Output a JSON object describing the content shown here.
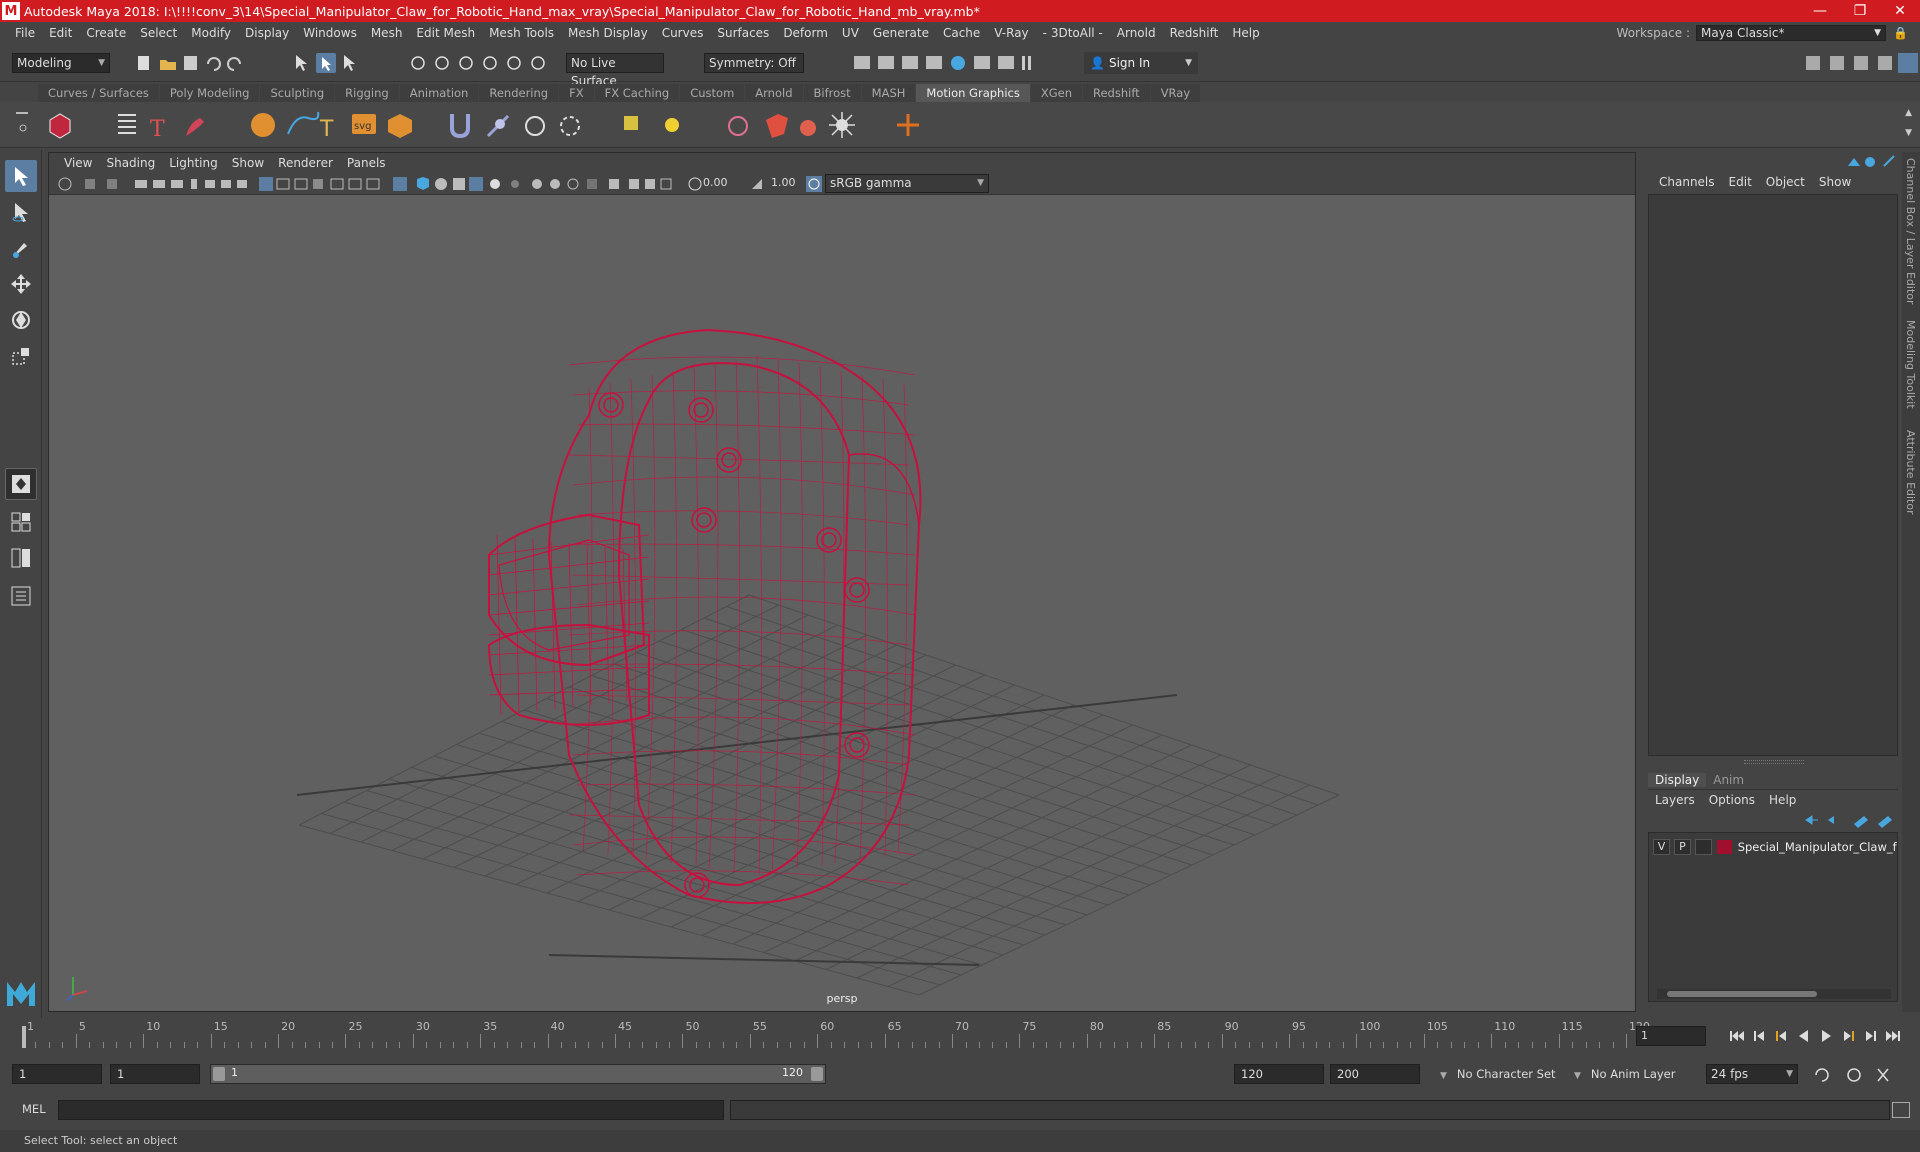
{
  "window": {
    "app_logo": "M",
    "title": "Autodesk Maya 2018: I:\\!!!!conv_3\\14\\Special_Manipulator_Claw_for_Robotic_Hand_max_vray\\Special_Manipulator_Claw_for_Robotic_Hand_mb_vray.mb*",
    "minimize": "—",
    "restore": "❐",
    "close": "✕"
  },
  "menubar": {
    "items": [
      "File",
      "Edit",
      "Create",
      "Select",
      "Modify",
      "Display",
      "Windows",
      "Mesh",
      "Edit Mesh",
      "Mesh Tools",
      "Mesh Display",
      "Curves",
      "Surfaces",
      "Deform",
      "UV",
      "Generate",
      "Cache",
      "V-Ray",
      "- 3DtoAll -",
      "Arnold",
      "Redshift",
      "Help"
    ],
    "workspace_label": "Workspace :",
    "workspace_value": "Maya Classic*"
  },
  "statusline": {
    "mode": "Modeling",
    "live_surface": "No Live Surface",
    "symmetry": "Symmetry: Off",
    "sign_in": "Sign In"
  },
  "shelf": {
    "tabs": [
      "Curves / Surfaces",
      "Poly Modeling",
      "Sculpting",
      "Rigging",
      "Animation",
      "Rendering",
      "FX",
      "FX Caching",
      "Custom",
      "Arnold",
      "Bifrost",
      "MASH",
      "Motion Graphics",
      "XGen",
      "Redshift",
      "VRay"
    ],
    "active_tab": "Motion Graphics",
    "svg_label": "svg",
    "text_label": "T"
  },
  "viewport": {
    "menu": [
      "View",
      "Shading",
      "Lighting",
      "Show",
      "Renderer",
      "Panels"
    ],
    "exposure": "0.00",
    "gamma": "1.00",
    "color_space": "sRGB gamma",
    "camera": "persp",
    "wire_color": "#c8103f"
  },
  "channel_box": {
    "menu": [
      "Channels",
      "Edit",
      "Object",
      "Show"
    ]
  },
  "layer_editor": {
    "tabs": [
      "Display",
      "Anim"
    ],
    "active_tab": "Display",
    "menu": [
      "Layers",
      "Options",
      "Help"
    ],
    "layer": {
      "visible": "V",
      "playback": "P",
      "name": "Special_Manipulator_Claw_for"
    }
  },
  "side_tabs": [
    "Channel Box / Layer Editor",
    "Modeling Toolkit",
    "Attribute Editor"
  ],
  "timeline": {
    "ticks": [
      "1",
      "5",
      "10",
      "15",
      "20",
      "25",
      "30",
      "35",
      "40",
      "45",
      "50",
      "55",
      "60",
      "65",
      "70",
      "75",
      "80",
      "85",
      "90",
      "95",
      "100",
      "105",
      "110",
      "115",
      "120"
    ],
    "current_frame": "1"
  },
  "range": {
    "start": "1",
    "playback_start": "1",
    "slider_start": "1",
    "slider_end": "120",
    "playback_end": "120",
    "end": "200",
    "character_set": "No Character Set",
    "anim_layer": "No Anim Layer",
    "fps": "24 fps"
  },
  "cmdline": {
    "label": "MEL"
  },
  "helpline": {
    "text": "Select Tool: select an object"
  }
}
